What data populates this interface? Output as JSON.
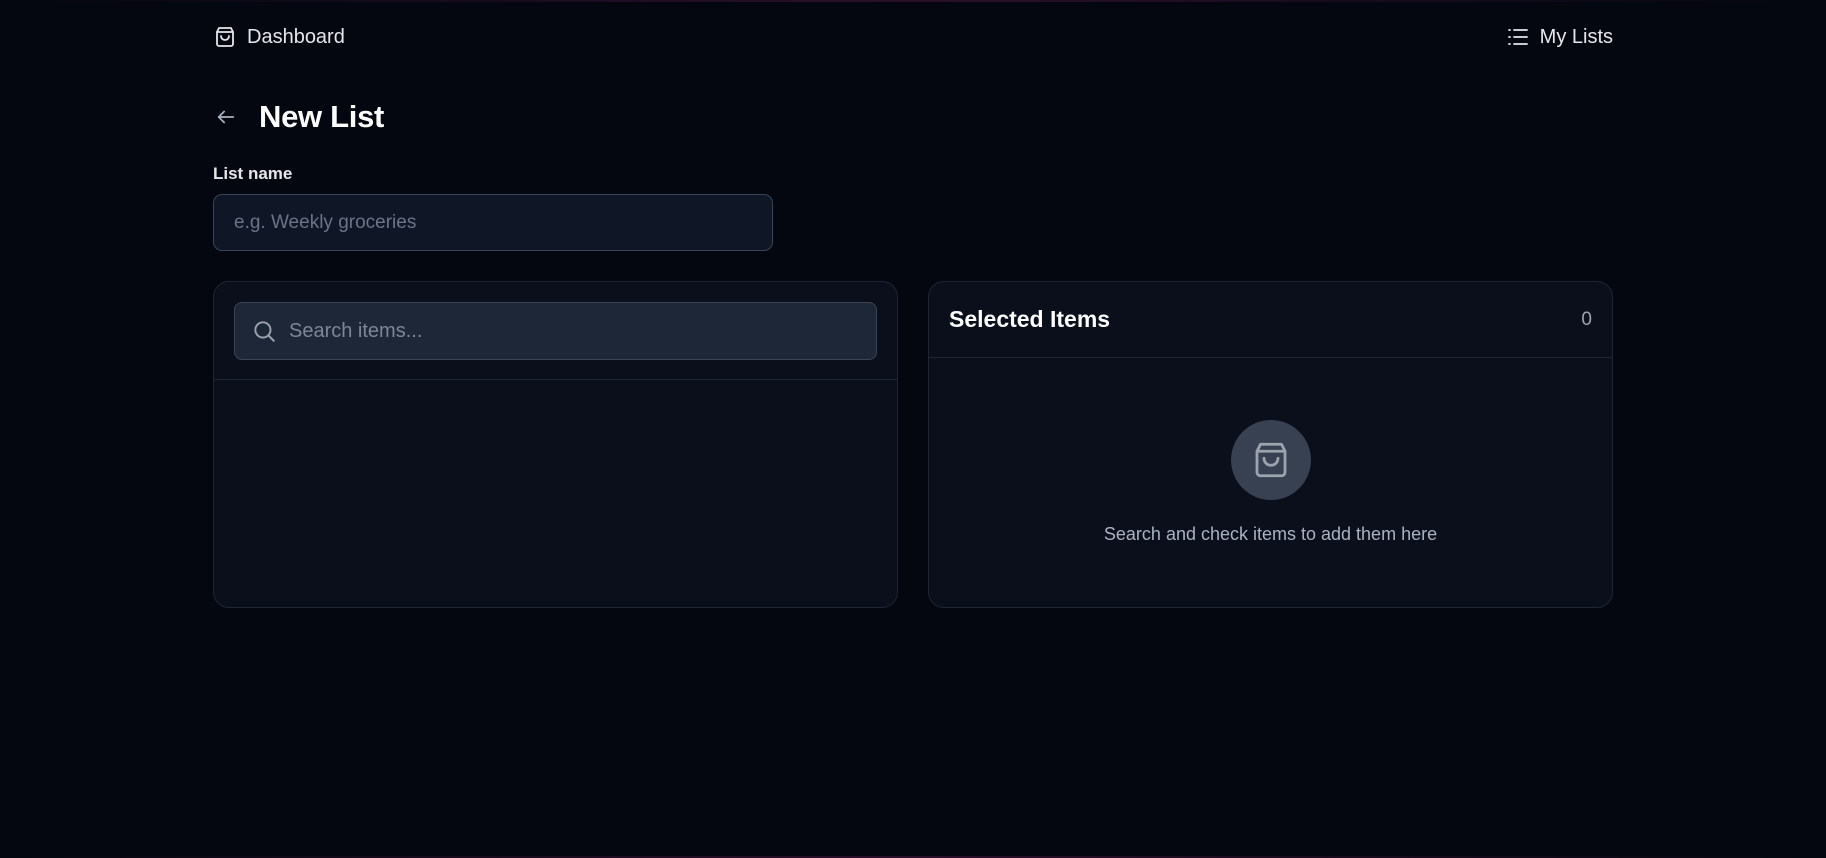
{
  "nav": {
    "dashboard_label": "Dashboard",
    "dashboard_icon": "shopping-bag-icon",
    "mylists_label": "My Lists",
    "mylists_icon": "list-icon"
  },
  "page": {
    "title": "New List",
    "back_icon": "arrow-left-icon"
  },
  "form": {
    "list_name_label": "List name",
    "list_name_value": "",
    "list_name_placeholder": "e.g. Weekly groceries"
  },
  "search": {
    "placeholder": "Search items...",
    "value": "",
    "icon": "search-icon"
  },
  "selected": {
    "title": "Selected Items",
    "count": "0",
    "empty_icon": "shopping-bag-icon",
    "empty_text": "Search and check items to add them here"
  },
  "colors": {
    "background": "#04070f",
    "panel": "#0a0f1b",
    "border": "#1e2533",
    "input_bg": "#0f1626",
    "search_bg": "#1e2737",
    "empty_icon_bg": "#374151"
  }
}
